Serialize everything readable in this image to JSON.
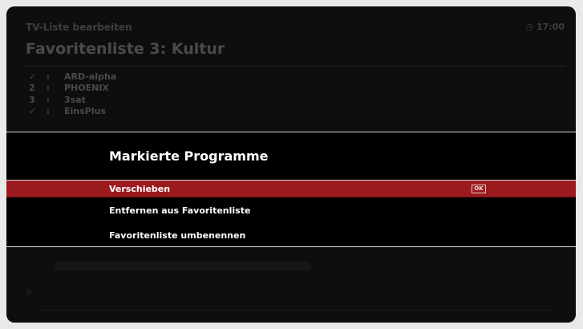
{
  "header": {
    "breadcrumb": "TV-Liste bearbeiten",
    "clock": "17:00",
    "title": "Favoritenliste 3: Kultur"
  },
  "channel_list": [
    {
      "marker": "✓",
      "name": "ARD-alpha"
    },
    {
      "marker": "2",
      "name": "PHOENIX"
    },
    {
      "marker": "3",
      "name": "3sat"
    },
    {
      "marker": "✓",
      "name": "EinsPlus"
    }
  ],
  "dialog": {
    "title": "Markierte Programme",
    "items": [
      {
        "label": "Verschieben",
        "selected": true,
        "badge": "OK"
      },
      {
        "label": "Entfernen aus Favoritenliste",
        "selected": false
      },
      {
        "label": "Favoritenliste umbenennen",
        "selected": false
      }
    ]
  },
  "colors": {
    "selection": "#9b1a1e",
    "background": "#0e0e0e",
    "frame": "#e9e9e9"
  }
}
